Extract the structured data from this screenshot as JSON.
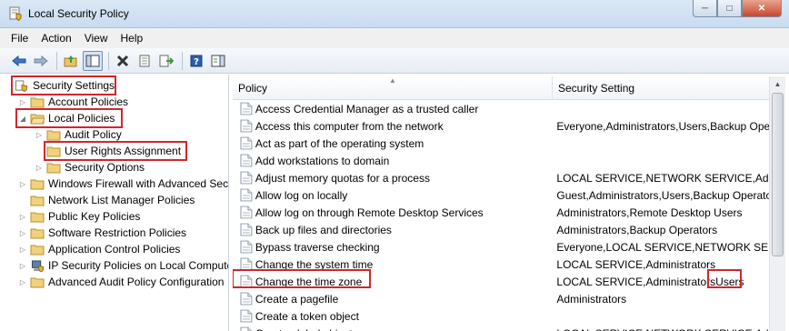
{
  "window": {
    "title": "Local Security Policy"
  },
  "menu": {
    "file": "File",
    "action": "Action",
    "view": "View",
    "help": "Help"
  },
  "toolbar_icons": [
    "back-icon",
    "forward-icon",
    "up-folder-icon",
    "show-hide-tree-icon",
    "delete-icon",
    "properties-icon",
    "export-icon",
    "help-icon",
    "show-action-pane-icon"
  ],
  "tree": {
    "root": "Security Settings",
    "account_policies": "Account Policies",
    "local_policies": "Local Policies",
    "audit_policy": "Audit Policy",
    "user_rights": "User Rights Assignment",
    "security_options": "Security Options",
    "firewall": "Windows Firewall with Advanced Secu",
    "nlm": "Network List Manager Policies",
    "pkp": "Public Key Policies",
    "srp": "Software Restriction Policies",
    "acp": "Application Control Policies",
    "ipsec": "IP Security Policies on Local Compute",
    "aapc": "Advanced Audit Policy Configuration"
  },
  "list": {
    "col_policy": "Policy",
    "col_setting": "Security Setting",
    "rows": [
      {
        "policy": "Access Credential Manager as a trusted caller",
        "setting": ""
      },
      {
        "policy": "Access this computer from the network",
        "setting": "Everyone,Administrators,Users,Backup Oper"
      },
      {
        "policy": "Act as part of the operating system",
        "setting": ""
      },
      {
        "policy": "Add workstations to domain",
        "setting": ""
      },
      {
        "policy": "Adjust memory quotas for a process",
        "setting": "LOCAL SERVICE,NETWORK SERVICE,Admini"
      },
      {
        "policy": "Allow log on locally",
        "setting": "Guest,Administrators,Users,Backup Operato"
      },
      {
        "policy": "Allow log on through Remote Desktop Services",
        "setting": "Administrators,Remote Desktop Users"
      },
      {
        "policy": "Back up files and directories",
        "setting": "Administrators,Backup Operators"
      },
      {
        "policy": "Bypass traverse checking",
        "setting": "Everyone,LOCAL SERVICE,NETWORK SERVIC"
      },
      {
        "policy": "Change the system time",
        "setting": "LOCAL SERVICE,Administrators"
      },
      {
        "policy": "Change the time zone",
        "setting": "LOCAL SERVICE,Administrators",
        "setting_extra": "Users"
      },
      {
        "policy": "Create a pagefile",
        "setting": "Administrators"
      },
      {
        "policy": "Create a token object",
        "setting": ""
      },
      {
        "policy": "Create global objects",
        "setting": "LOCAL SERVICE,NETWORK SERVICE,Admini"
      }
    ]
  },
  "colors": {
    "highlight_box": "#d0262d",
    "title_bar": "#dbe8f6"
  }
}
